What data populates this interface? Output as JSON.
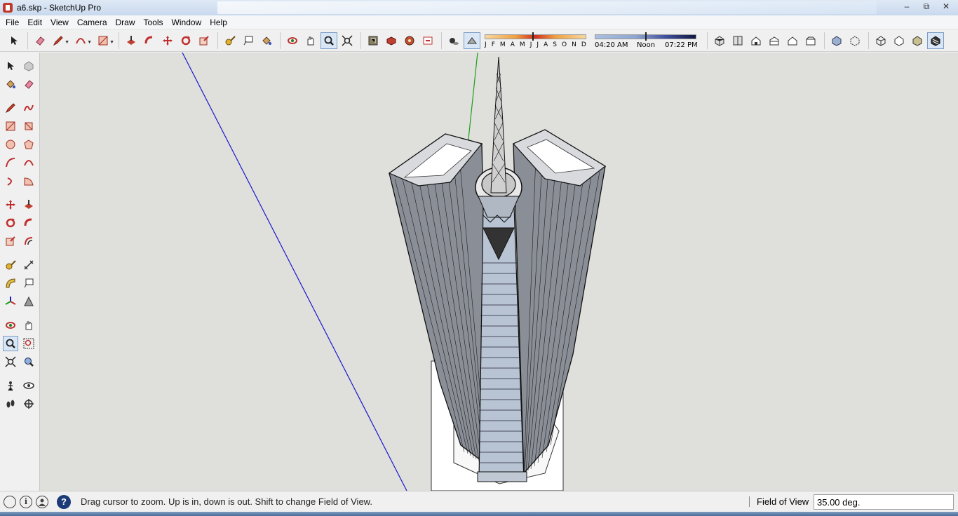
{
  "window": {
    "title": "a6.skp - SketchUp Pro",
    "controls": {
      "minimize": "–",
      "maximize": "⧉",
      "close": "✕"
    }
  },
  "menu": [
    "File",
    "Edit",
    "View",
    "Camera",
    "Draw",
    "Tools",
    "Window",
    "Help"
  ],
  "shadow_settings": {
    "months": [
      "J",
      "F",
      "M",
      "A",
      "M",
      "J",
      "J",
      "A",
      "S",
      "O",
      "N",
      "D"
    ],
    "time_start": "04:20 AM",
    "time_mid": "Noon",
    "time_end": "07:22 PM"
  },
  "status": {
    "message": "Drag cursor to zoom.  Up is in, down is out. Shift to change Field of View.",
    "vcb_label": "Field of View",
    "vcb_value": "35.00 deg.",
    "help_glyph": "?",
    "info_glyph": "i"
  },
  "icons": {
    "toolbar": [
      "select-icon",
      "eraser-icon",
      "pencil-icon",
      "arc-icon",
      "rectangle-icon",
      "push-pull-icon",
      "follow-me-icon",
      "move-icon",
      "rotate-icon",
      "scale-icon",
      "tape-measure-icon",
      "text-icon",
      "paint-bucket-icon",
      "orbit-icon",
      "pan-icon",
      "zoom-icon",
      "zoom-extents-icon",
      "3d-warehouse-icon",
      "extension-warehouse-icon",
      "layout-icon",
      "send-to-layout-icon",
      "shadows-toggle-icon",
      "fog-toggle-icon",
      "iso-view-icon",
      "top-view-icon",
      "front-view-icon",
      "right-view-icon",
      "back-view-icon",
      "left-view-icon",
      "xray-icon",
      "back-edges-icon",
      "wireframe-icon",
      "hidden-line-icon",
      "shaded-icon",
      "shaded-textures-icon",
      "monochrome-icon"
    ],
    "left": [
      "select-icon",
      "component-icon",
      "paint-bucket-icon",
      "eraser-icon",
      "pencil-icon",
      "freehand-icon",
      "rectangle-icon",
      "rotated-rectangle-icon",
      "circle-icon",
      "polygon-icon",
      "arc-icon",
      "two-point-arc-icon",
      "three-point-arc-icon",
      "pie-icon",
      "move-icon",
      "push-pull-icon",
      "rotate-icon",
      "follow-me-icon",
      "scale-icon",
      "offset-icon",
      "tape-measure-icon",
      "dimension-icon",
      "protractor-icon",
      "text-icon",
      "axes-icon",
      "3d-text-icon",
      "orbit-icon",
      "pan-icon",
      "zoom-icon",
      "zoom-window-icon",
      "zoom-extents-icon",
      "previous-view-icon",
      "position-camera-icon",
      "look-around-icon",
      "walk-icon",
      "section-plane-icon"
    ]
  },
  "colors": {
    "viewport_bg": "#dfdfdc",
    "axis_blue": "#1a1acc",
    "axis_green": "#1aa01a",
    "accent_red": "#c0392b"
  }
}
